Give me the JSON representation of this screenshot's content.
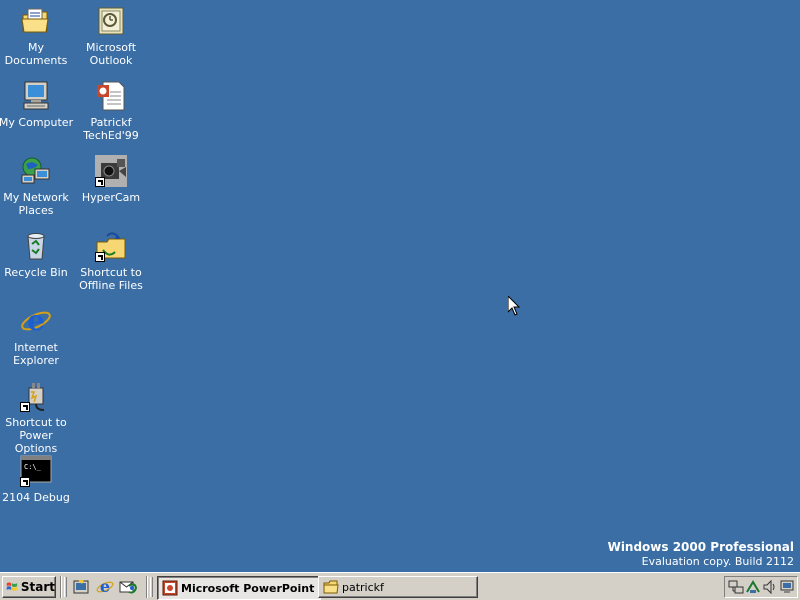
{
  "desktop": {
    "background_color": "#3a6ea5",
    "icons": [
      {
        "label": "My Documents",
        "icon": "folder-documents-icon"
      },
      {
        "label": "Microsoft\nOutlook",
        "icon": "outlook-icon"
      },
      {
        "label": "My Computer",
        "icon": "computer-icon"
      },
      {
        "label": "Patrickf\nTechEd'99",
        "icon": "powerpoint-file-icon"
      },
      {
        "label": "My Network\nPlaces",
        "icon": "network-icon"
      },
      {
        "label": "HyperCam",
        "icon": "camera-icon"
      },
      {
        "label": "Recycle Bin",
        "icon": "recycle-bin-icon"
      },
      {
        "label": "Shortcut to\nOffline Files",
        "icon": "offline-files-icon"
      },
      {
        "label": "Internet\nExplorer",
        "icon": "internet-explorer-icon"
      },
      {
        "label": "Shortcut to\nPower Options",
        "icon": "power-options-icon"
      },
      {
        "label": "2104 Debug",
        "icon": "console-icon"
      }
    ]
  },
  "watermark": {
    "title": "Windows 2000 Professional",
    "build": "Evaluation copy. Build 2112"
  },
  "taskbar": {
    "start_label": "Start",
    "quick_launch": [
      "show-desktop-icon",
      "internet-explorer-icon",
      "outlook-express-icon"
    ],
    "tasks": [
      {
        "label": "Microsoft PowerPoint ...",
        "icon": "powerpoint-icon",
        "active": true
      },
      {
        "label": "patrickf",
        "icon": "folder-icon",
        "active": false
      }
    ],
    "tray_icons": [
      "network-connection-icon",
      "scheduler-icon",
      "volume-icon",
      "display-icon"
    ]
  }
}
